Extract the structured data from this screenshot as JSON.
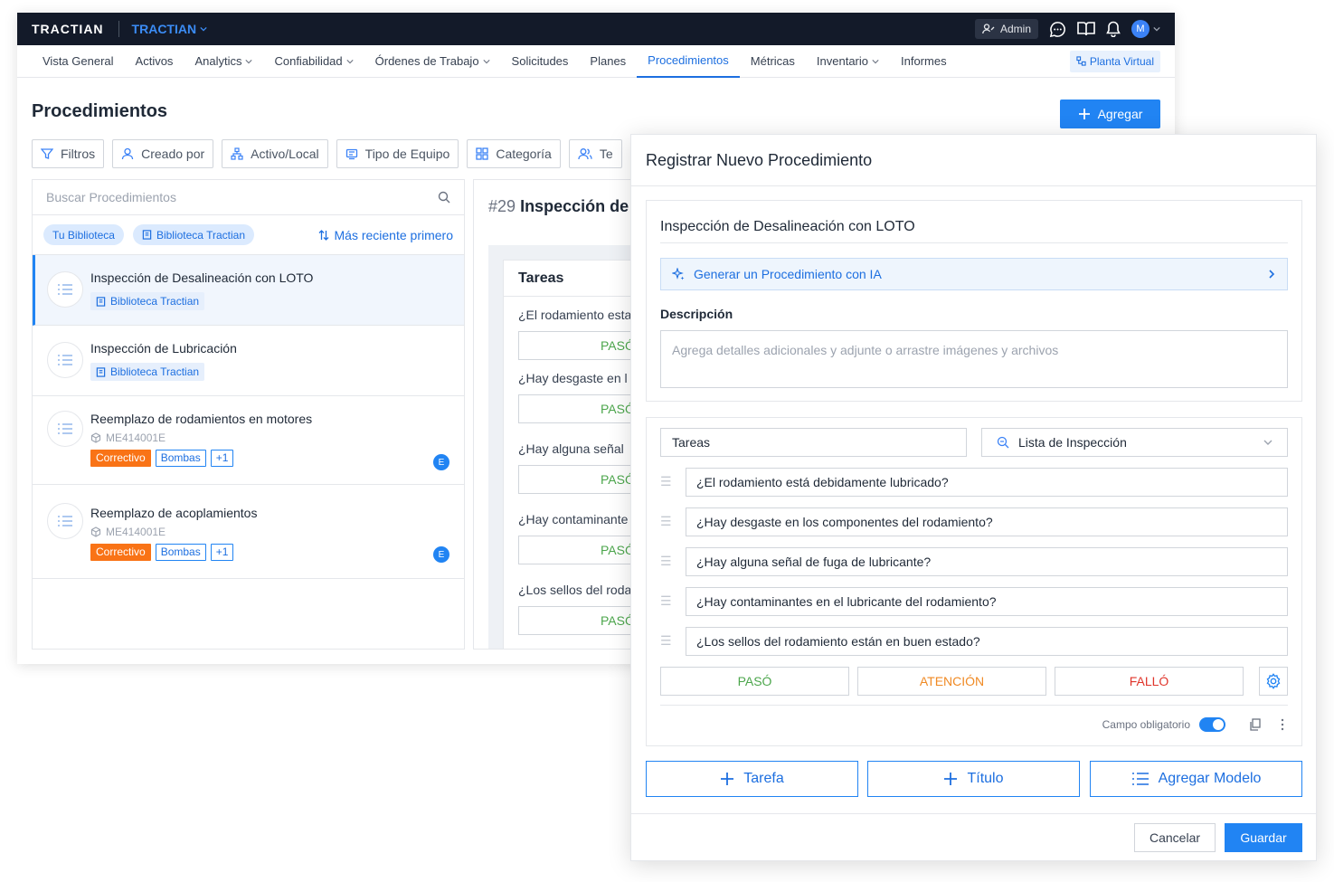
{
  "topbar": {
    "logo": "TRACTIAN",
    "company": "TRACTIAN",
    "admin_label": "Admin",
    "user_initial": "M"
  },
  "nav": {
    "items": [
      {
        "label": "Vista General",
        "dropdown": false
      },
      {
        "label": "Activos",
        "dropdown": false
      },
      {
        "label": "Analytics",
        "dropdown": true
      },
      {
        "label": "Confiabilidad",
        "dropdown": true
      },
      {
        "label": "Órdenes de Trabajo",
        "dropdown": true
      },
      {
        "label": "Solicitudes",
        "dropdown": false
      },
      {
        "label": "Planes",
        "dropdown": false
      },
      {
        "label": "Procedimientos",
        "dropdown": false,
        "active": true
      },
      {
        "label": "Métricas",
        "dropdown": false
      },
      {
        "label": "Inventario",
        "dropdown": true
      },
      {
        "label": "Informes",
        "dropdown": false
      }
    ],
    "virtual_plant": "Planta Virtual"
  },
  "page": {
    "title": "Procedimientos",
    "add_label": "Agregar",
    "filters": [
      "Filtros",
      "Creado por",
      "Activo/Local",
      "Tipo de Equipo",
      "Categoría",
      "Te"
    ]
  },
  "list": {
    "search_placeholder": "Buscar Procedimientos",
    "libraries": [
      "Tu Biblioteca",
      "Biblioteca Tractian"
    ],
    "sort_label": "Más reciente primero",
    "items": [
      {
        "name": "Inspección de Desalineación con LOTO",
        "badge": "Biblioteca Tractian"
      },
      {
        "name": "Inspección de Lubricación",
        "badge": "Biblioteca Tractian"
      },
      {
        "name": "Reemplazo de rodamientos en motores",
        "code": "ME414001E",
        "tags": [
          "Correctivo",
          "Bombas",
          "+1"
        ],
        "assignee": "E"
      },
      {
        "name": "Reemplazo de acoplamientos",
        "code": "ME414001E",
        "tags": [
          "Correctivo",
          "Bombas",
          "+1"
        ],
        "assignee": "E"
      }
    ]
  },
  "detail": {
    "number": "#29",
    "title": "Inspección de",
    "tasks_header": "Tareas",
    "questions": [
      "¿El rodamiento esta",
      "¿Hay desgaste en l",
      "¿Hay alguna señal",
      "¿Hay contaminante",
      "¿Los sellos del roda"
    ],
    "pass_label": "PASÓ"
  },
  "modal": {
    "title": "Registrar Nuevo Procedimiento",
    "name_value": "Inspección de Desalineación con LOTO",
    "ai_label": "Generar un Procedimiento con IA",
    "description_label": "Descripción",
    "description_placeholder": "Agrega detalles adicionales y adjunte o arrastre imágenes y archivos",
    "task_name": "Tareas",
    "task_type": "Lista de Inspección",
    "questions": [
      "¿El rodamiento está debidamente lubricado?",
      "¿Hay desgaste en los componentes del rodamiento?",
      "¿Hay alguna señal de fuga de lubricante?",
      "¿Hay contaminantes en el lubricante del rodamiento?",
      "¿Los sellos del rodamiento están en buen estado?"
    ],
    "options": [
      {
        "label": "PASÓ",
        "color": "#4ca64c"
      },
      {
        "label": "ATENCIÓN",
        "color": "#f08a24"
      },
      {
        "label": "FALLÓ",
        "color": "#e0352b"
      }
    ],
    "required_label": "Campo obligatorio",
    "add_task": "Tarefa",
    "add_title": "Título",
    "add_model": "Agregar Modelo",
    "cancel": "Cancelar",
    "save": "Guardar"
  },
  "colors": {
    "primary": "#2184f3",
    "topbar": "#131a29",
    "correctivo": "#f97316"
  }
}
